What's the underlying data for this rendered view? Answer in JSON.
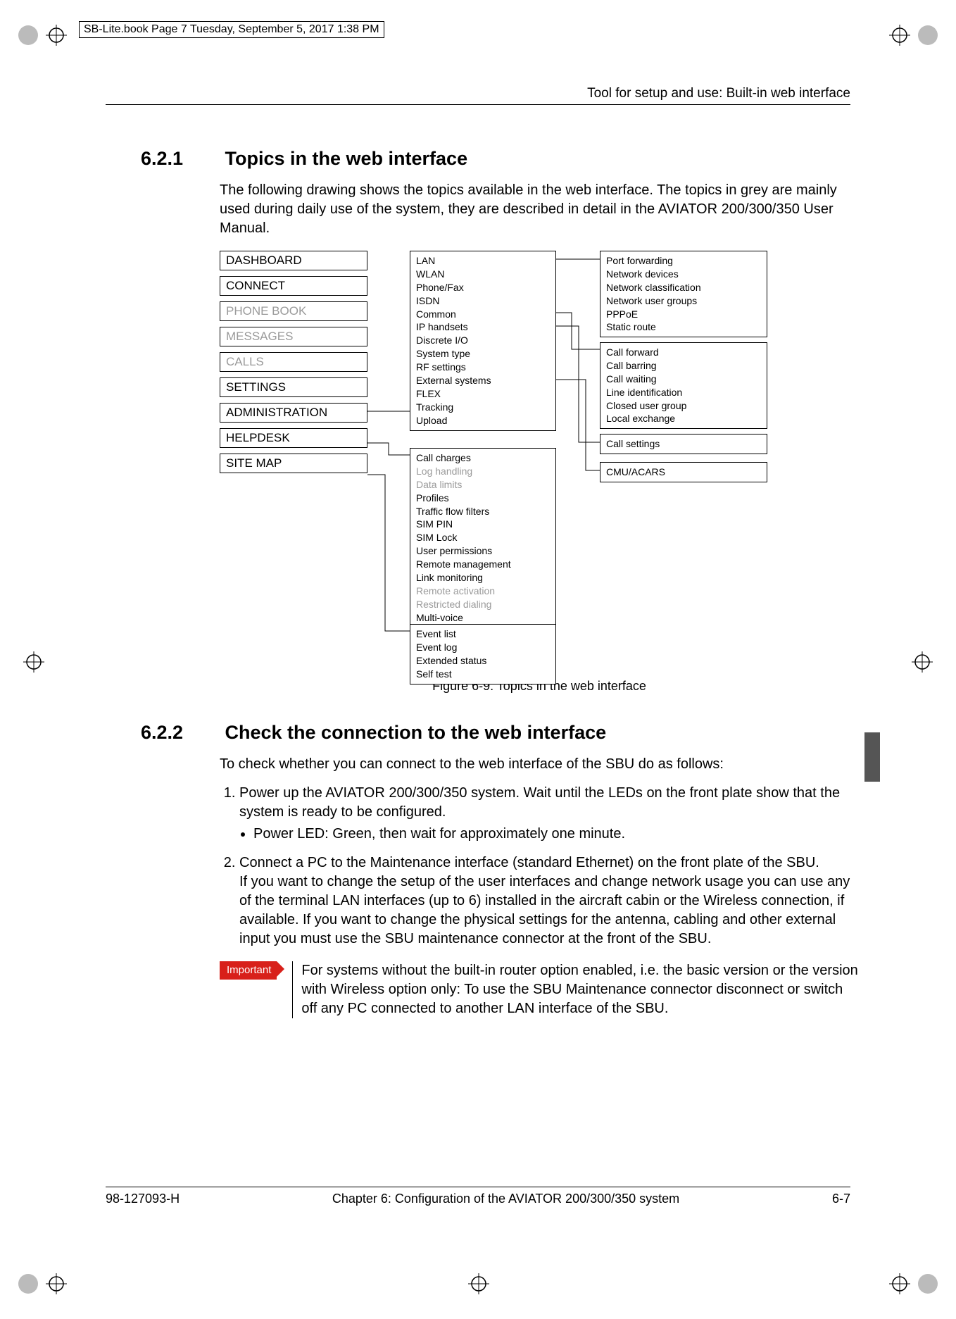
{
  "frame_header": "SB-Lite.book  Page 7  Tuesday, September 5, 2017  1:38 PM",
  "running_head": "Tool for setup and use: Built-in web interface",
  "section_621_num": "6.2.1",
  "section_621_title": "Topics in the web interface",
  "intro_621": "The following drawing shows the topics available in the web interface. The topics in grey are mainly used during daily use of the system, they are described in detail in the AVIATOR 200/300/350 User Manual.",
  "nav": {
    "dashboard": "DASHBOARD",
    "connect": "CONNECT",
    "phonebook": "PHONE BOOK",
    "messages": "MESSAGES",
    "calls": "CALLS",
    "settings": "SETTINGS",
    "administration": "ADMINISTRATION",
    "helpdesk": "HELPDESK",
    "sitemap": "SITE MAP"
  },
  "panel_settings": {
    "lan": "LAN",
    "wlan": "WLAN",
    "phonefax": "Phone/Fax",
    "isdn": "ISDN",
    "common": "Common",
    "iphandsets": "IP handsets",
    "discreteio": "Discrete I/O",
    "systemtype": "System type",
    "rfsettings": "RF settings",
    "extsys": "External systems",
    "flex": "FLEX",
    "tracking": "Tracking",
    "upload": "Upload"
  },
  "panel_admin": {
    "callcharges": "Call charges",
    "loghandling": "Log handling",
    "datalimits": "Data limits",
    "profiles": "Profiles",
    "trafficflow": "Traffic flow filters",
    "simpin": "SIM PIN",
    "simlock": "SIM Lock",
    "userperm": "User permissions",
    "remotemgmt": "Remote management",
    "linkmon": "Link monitoring",
    "remoteact": "Remote activation",
    "restricted": "Restricted dialing",
    "multivoice": "Multi-voice"
  },
  "panel_help": {
    "eventlist": "Event list",
    "eventlog": "Event log",
    "extstatus": "Extended status",
    "selftest": "Self test"
  },
  "panel_net": {
    "portfwd": "Port forwarding",
    "netdev": "Network devices",
    "netclass": "Network classification",
    "netgroups": "Network user groups",
    "pppoe": "PPPoE",
    "staticroute": "Static route"
  },
  "panel_call": {
    "callfwd": "Call forward",
    "callbar": "Call barring",
    "callwait": "Call waiting",
    "lineid": "Line identification",
    "closedug": "Closed user group",
    "localex": "Local exchange"
  },
  "panel_csettings": {
    "label": "Call settings"
  },
  "panel_cmu": {
    "label": "CMU/ACARS"
  },
  "figure_caption": "Figure 6-9: Topics in the web interface",
  "section_622_num": "6.2.2",
  "section_622_title": "Check the connection to the web interface",
  "intro_622": "To check whether you can connect to the web interface of the SBU do as follows:",
  "step1a": "Power up the AVIATOR 200/300/350 system. Wait until the LEDs on the front plate show that the system is ready to be configured.",
  "step1b": "Power LED: Green, then wait for approximately one minute.",
  "step2a": "Connect a PC to the Maintenance interface (standard Ethernet) on the front plate of the SBU.",
  "step2b": "If you want to change the setup of the user interfaces and change network usage you can use any of the terminal LAN interfaces (up to 6) installed in the aircraft cabin or the Wireless connection, if available. If you want to change the physical settings for the antenna, cabling and other external input you must use the SBU maintenance connector at the front of the SBU.",
  "important_label": "Important",
  "important_text": "For systems without the built-in router option enabled, i.e. the basic version or the version with Wireless option only: To use the SBU Maintenance connector disconnect or switch off any PC connected to another LAN interface of the SBU.",
  "footer_left": "98-127093-H",
  "footer_center": "Chapter 6:  Configuration of the AVIATOR 200/300/350 system",
  "footer_right": "6-7"
}
